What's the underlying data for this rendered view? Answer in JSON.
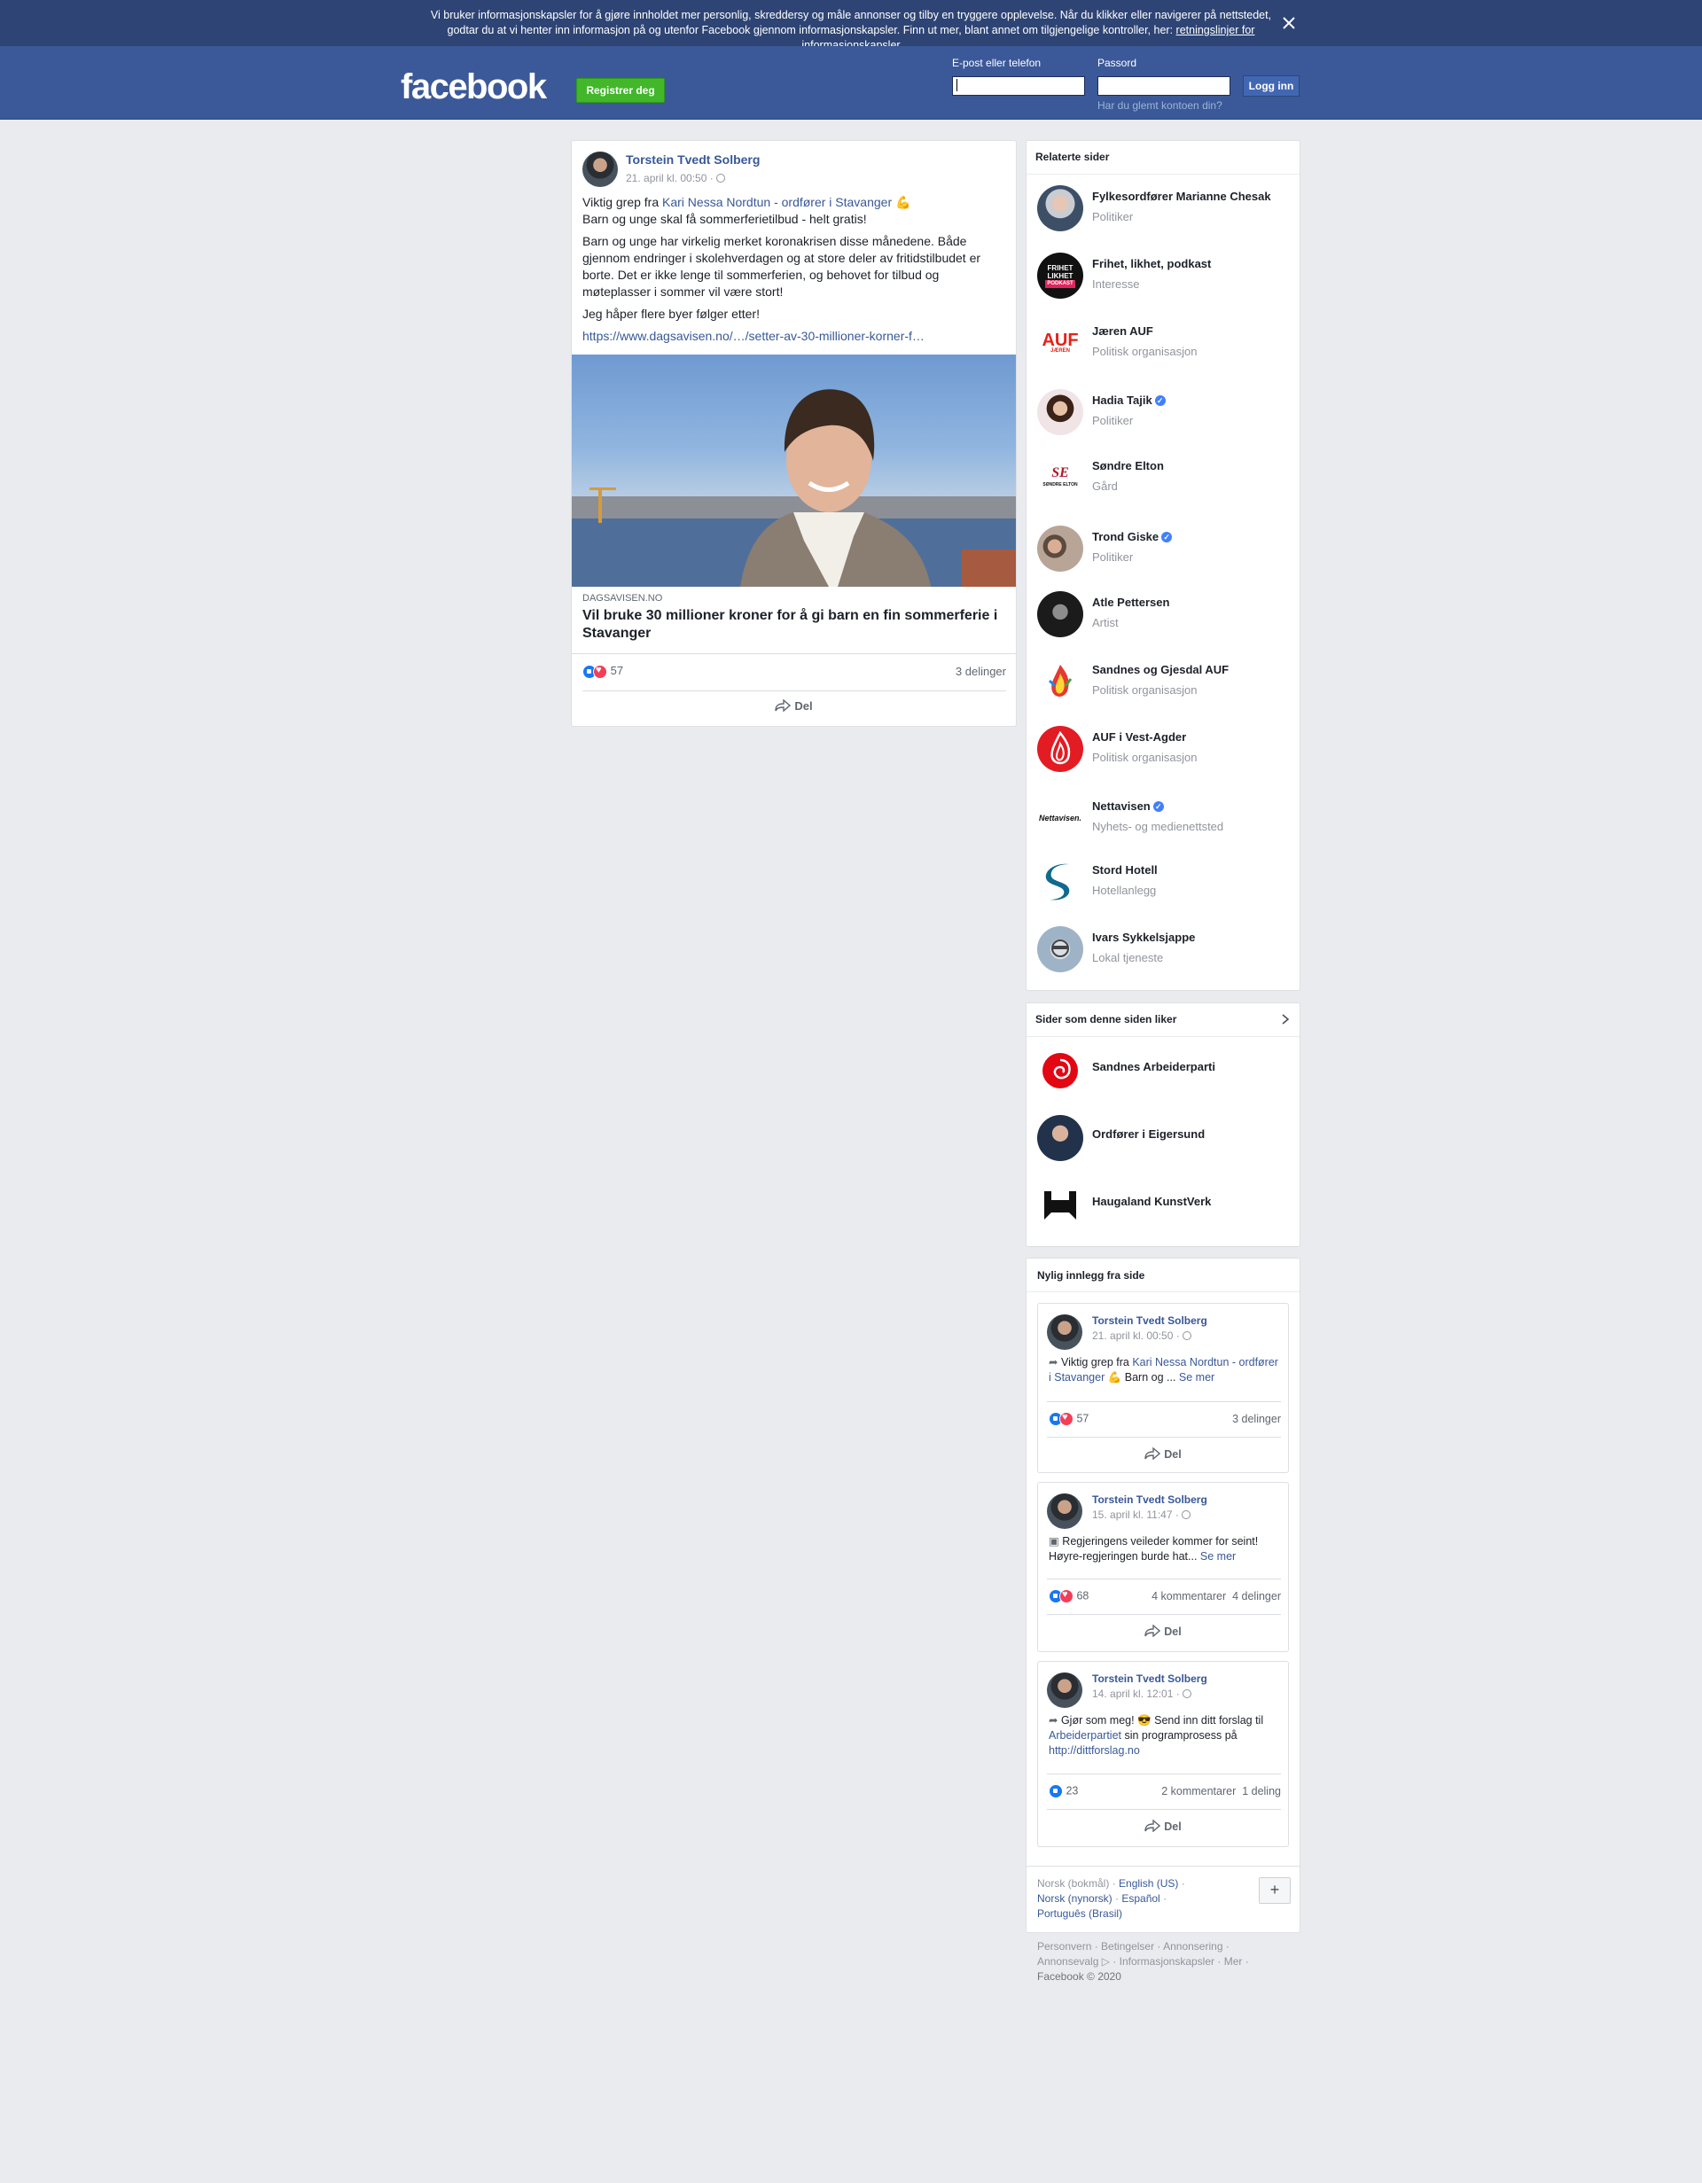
{
  "cookie_banner": {
    "text": "Vi bruker informasjonskapsler for å gjøre innholdet mer personlig, skreddersy og måle annonser og tilby en tryggere opplevelse. Når du klikker eller navigerer på nettstedet, godtar du at vi henter inn informasjon på og utenfor Facebook gjennom informasjonskapsler. Finn ut mer, blant annet om tilgjengelige kontroller, her: ",
    "link": "retningslinjer for informasjonskapsler"
  },
  "header": {
    "logo": "facebook",
    "register_label": "Registrer deg",
    "email_label": "E-post eller telefon",
    "password_label": "Passord",
    "login_label": "Logg inn",
    "forgot_label": "Har du glemt kontoen din?"
  },
  "post": {
    "author": "Torstein Tvedt Solberg",
    "timestamp": "21. april kl. 00:50 · ",
    "line1_prefix": "Viktig grep fra ",
    "line1_link": "Kari Nessa Nordtun - ordfører i Stavanger",
    "line1_emoji": " 💪",
    "line2": "Barn og unge skal få sommerferietilbud - helt gratis!",
    "para2": "Barn og unge har virkelig merket koronakrisen disse månedene. Både gjennom endringer i skolehverdagen og at store deler av fritidstilbudet er borte. Det er ikke lenge til sommerferien, og behovet for tilbud og møteplasser i sommer vil være stort!",
    "para3": "Jeg håper flere byer følger etter!",
    "url": "https://www.dagsavisen.no/…/setter-av-30-millioner-korner-f…",
    "source": "DAGSAVISEN.NO",
    "headline": "Vil bruke 30 millioner kroner for å gi barn en fin sommerferie i Stavanger",
    "reactions": "57",
    "shares": "3 delinger",
    "share_label": "Del"
  },
  "related": {
    "title": "Relaterte sider",
    "items": [
      {
        "name": "Fylkesordfører Marianne Chesak",
        "category": "Politiker",
        "verified": false
      },
      {
        "name": "Frihet, likhet, podkast",
        "category": "Interesse",
        "verified": false
      },
      {
        "name": "Jæren AUF",
        "category": "Politisk organisasjon",
        "verified": false
      },
      {
        "name": "Hadia Tajik",
        "category": "Politiker",
        "verified": true
      },
      {
        "name": "Søndre Elton",
        "category": "Gård",
        "verified": false
      },
      {
        "name": "Trond Giske",
        "category": "Politiker",
        "verified": true
      },
      {
        "name": "Atle Pettersen",
        "category": "Artist",
        "verified": false
      },
      {
        "name": "Sandnes og Gjesdal AUF",
        "category": "Politisk organisasjon",
        "verified": false
      },
      {
        "name": "AUF i Vest-Agder",
        "category": "Politisk organisasjon",
        "verified": false
      },
      {
        "name": "Nettavisen",
        "category": "Nyhets- og medienettsted",
        "verified": true
      },
      {
        "name": "Stord Hotell",
        "category": "Hotellanlegg",
        "verified": false
      },
      {
        "name": "Ivars Sykkelsjappe",
        "category": "Lokal tjeneste",
        "verified": false
      }
    ],
    "logo_texts": {
      "podcast": "FRIHET LIKHET",
      "podcast_sub": "PODKAST",
      "jaeren": "AUF",
      "jaeren_sub": "JÆREN",
      "elton_mark": "SE",
      "elton": "SØNDRE ELTON",
      "nettavisen": "Nettavisen."
    }
  },
  "liked": {
    "title": "Sider som denne siden liker",
    "items": [
      {
        "name": "Sandnes Arbeiderparti"
      },
      {
        "name": "Ordfører i Eigersund"
      },
      {
        "name": "Haugaland KunstVerk"
      }
    ]
  },
  "recent": {
    "title": "Nylig innlegg fra side",
    "see_more": "Se mer",
    "share_label": "Del",
    "posts": [
      {
        "author": "Torstein Tvedt Solberg",
        "time": "21. april kl. 00:50 · ",
        "text_prefix": "Viktig grep fra ",
        "text_link": "Kari Nessa Nordtun - ordfører i Stavanger",
        "text_suffix": " 💪 Barn og ... ",
        "reactions": "57",
        "comments": "",
        "shares": "3 delinger"
      },
      {
        "author": "Torstein Tvedt Solberg",
        "time": "15. april kl. 11:47 · ",
        "text": "Regjeringens veileder kommer for seint! Høyre-regjeringen burde hat... ",
        "reactions": "68",
        "comments": "4 kommentarer",
        "shares": "4 delinger"
      },
      {
        "author": "Torstein Tvedt Solberg",
        "time": "14. april kl. 12:01 · ",
        "text_prefix": "Gjør som meg! 😎 Send inn ditt forslag til ",
        "text_link": "Arbeiderpartiet",
        "text_suffix": " sin programprosess på ",
        "text_url": "http://dittforslag.no",
        "reactions": "23",
        "comments": "2 kommentarer",
        "shares": "1 deling"
      }
    ]
  },
  "languages": {
    "current": "Norsk (bokmål)",
    "options": [
      "English (US)",
      "Norsk (nynorsk)",
      "Español",
      "Português (Brasil)"
    ],
    "more_label": "+"
  },
  "footer": {
    "links": [
      "Personvern",
      "Betingelser",
      "Annonsering",
      "Annonsevalg",
      "Informasjonskapsler",
      "Mer"
    ],
    "copyright": "Facebook © 2020"
  },
  "colors": {
    "brand": "#3b5998",
    "banner": "#2d4474",
    "register": "#42b72a",
    "link": "#385898"
  }
}
